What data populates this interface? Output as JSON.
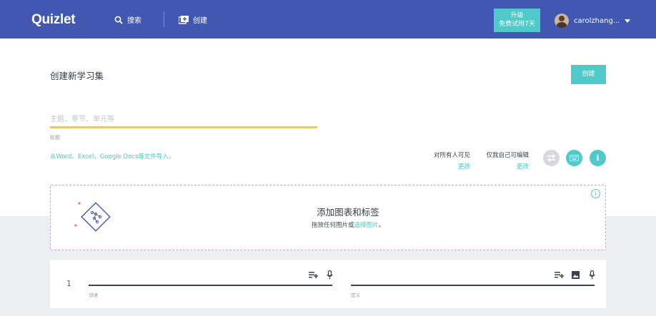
{
  "nav": {
    "logo": "Quizlet",
    "search_label": "搜索",
    "create_label": "创建",
    "upgrade_line1": "升级",
    "upgrade_line2": "免费试用7天",
    "username": "carolzhang...",
    "brand_color": "#4257b2",
    "accent_color": "#4fc9c9"
  },
  "page": {
    "title": "创建新学习集",
    "create_button": "创建",
    "title_placeholder": "主题、章节、单元等",
    "title_caption": "标题",
    "import_link": "从Word、Excel、Google Docs等文件导入。",
    "visibility": {
      "view_label": "对所有人可见",
      "view_change": "更改",
      "edit_label": "仅我自己可编辑",
      "edit_change": "更改"
    }
  },
  "image_area": {
    "title": "添加图表和标签",
    "subtitle_prefix": "拖放任何图片或",
    "subtitle_link": "选择图片",
    "subtitle_suffix": "。"
  },
  "card": {
    "number": "1",
    "term_caption": "词语",
    "definition_caption": "定义"
  },
  "icons": {
    "search": "search-icon",
    "create": "create-set-icon",
    "dropdown": "chevron-down-icon",
    "swap": "swap-icon",
    "keyboard": "keyboard-icon",
    "info": "info-icon",
    "diagram": "diagram-icon",
    "add_list": "add-list-icon",
    "mic": "microphone-icon",
    "image": "image-icon"
  }
}
